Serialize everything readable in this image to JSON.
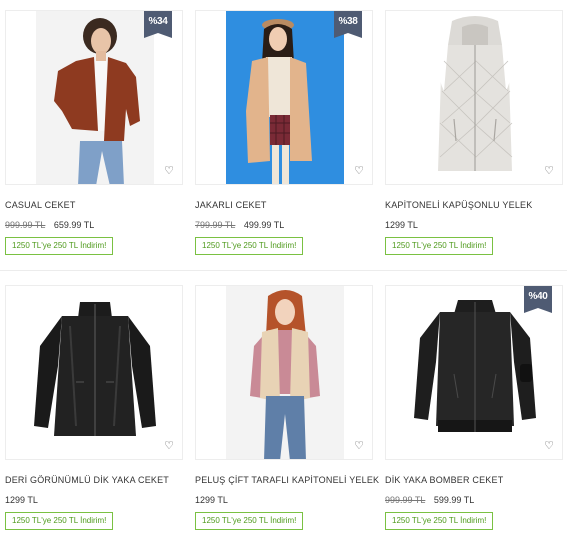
{
  "products": [
    {
      "title": "CASUAL CEKET",
      "old_price": "999.99 TL",
      "price": "659.99 TL",
      "badge": "%34",
      "promo": "1250 TL'ye 250 TL İndirim!",
      "fav_icon": "heart-icon"
    },
    {
      "title": "JAKARLI CEKET",
      "old_price": "799.99 TL",
      "price": "499.99 TL",
      "badge": "%38",
      "promo": "1250 TL'ye 250 TL İndirim!",
      "fav_icon": "heart-icon"
    },
    {
      "title": "KAPİTONELİ KAPÜŞONLU YELEK",
      "old_price": "",
      "price": "1299 TL",
      "badge": "",
      "promo": "1250 TL'ye 250 TL İndirim!",
      "fav_icon": "heart-icon"
    },
    {
      "title": "DERİ GÖRÜNÜMLÜ DİK YAKA CEKET",
      "old_price": "",
      "price": "1299 TL",
      "badge": "",
      "promo": "1250 TL'ye 250 TL İndirim!",
      "fav_icon": "heart-icon"
    },
    {
      "title": "PELUŞ ÇİFT TARAFLI KAPİTONELİ YELEK",
      "old_price": "",
      "price": "1299 TL",
      "badge": "",
      "promo": "1250 TL'ye 250 TL İndirim!",
      "fav_icon": "heart-icon"
    },
    {
      "title": "DİK YAKA BOMBER CEKET",
      "old_price": "999.99 TL",
      "price": "599.99 TL",
      "badge": "%40",
      "promo": "1250 TL'ye 250 TL İndirim!",
      "fav_icon": "heart-icon"
    }
  ],
  "colors": {
    "badge": "#4f5b73",
    "promo_border": "#7ac142",
    "promo_text": "#4e9a1c"
  }
}
